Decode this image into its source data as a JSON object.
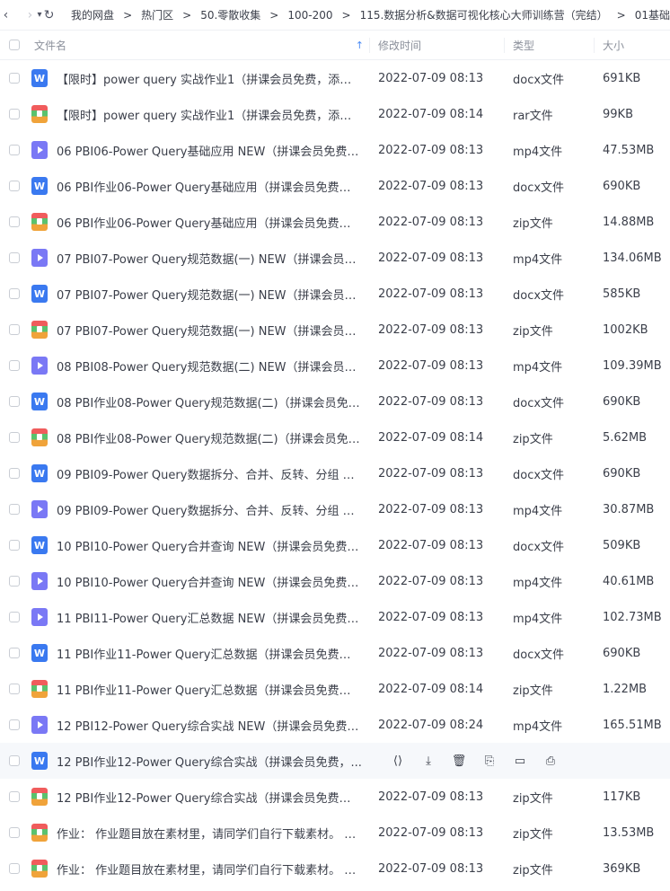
{
  "nav": {
    "back": "‹",
    "forward": "›",
    "dropdown": "▾",
    "refresh": "↻"
  },
  "breadcrumbs": [
    "我的网盘",
    "热门区",
    "50.零散收集",
    "100-200",
    "115.数据分析&数据可视化核心大师训练营（完结）",
    "01基础"
  ],
  "crumb_sep": ">",
  "columns": {
    "name": "文件名",
    "time": "修改时间",
    "type": "类型",
    "size": "大小"
  },
  "files": [
    {
      "icon": "docx",
      "name": "【限时】power query 实战作业1（拼课会员免费，添加微信...",
      "time": "2022-07-09 08:13",
      "type": "docx文件",
      "size": "691KB"
    },
    {
      "icon": "zip",
      "name": "【限时】power query 实战作业1（拼课会员免费，添加微信...",
      "time": "2022-07-09 08:14",
      "type": "rar文件",
      "size": "99KB"
    },
    {
      "icon": "mp4",
      "name": "06  PBI06-Power Query基础应用 NEW（拼课会员免费，添...",
      "time": "2022-07-09 08:13",
      "type": "mp4文件",
      "size": "47.53MB"
    },
    {
      "icon": "docx",
      "name": "06 PBI作业06-Power Query基础应用（拼课会员免费，添加...",
      "time": "2022-07-09 08:13",
      "type": "docx文件",
      "size": "690KB"
    },
    {
      "icon": "zip",
      "name": "06 PBI作业06-Power Query基础应用（拼课会员免费，添加...",
      "time": "2022-07-09 08:13",
      "type": "zip文件",
      "size": "14.88MB"
    },
    {
      "icon": "mp4",
      "name": "07 PBI07-Power Query规范数据(一) NEW（拼课会员免费，...",
      "time": "2022-07-09 08:13",
      "type": "mp4文件",
      "size": "134.06MB"
    },
    {
      "icon": "docx",
      "name": "07 PBI07-Power Query规范数据(一) NEW（拼课会员免费，...",
      "time": "2022-07-09 08:13",
      "type": "docx文件",
      "size": "585KB"
    },
    {
      "icon": "zip",
      "name": "07 PBI07-Power Query规范数据(一) NEW（拼课会员免费，...",
      "time": "2022-07-09 08:13",
      "type": "zip文件",
      "size": "1002KB"
    },
    {
      "icon": "mp4",
      "name": "08 PBI08-Power Query规范数据(二) NEW（拼课会员免费，...",
      "time": "2022-07-09 08:13",
      "type": "mp4文件",
      "size": "109.39MB"
    },
    {
      "icon": "docx",
      "name": "08 PBI作业08-Power Query规范数据(二)（拼课会员免费，...",
      "time": "2022-07-09 08:13",
      "type": "docx文件",
      "size": "690KB"
    },
    {
      "icon": "zip",
      "name": "08 PBI作业08-Power Query规范数据(二)（拼课会员免费，...",
      "time": "2022-07-09 08:14",
      "type": "zip文件",
      "size": "5.62MB"
    },
    {
      "icon": "docx",
      "name": "09 PBI09-Power Query数据拆分、合并、反转、分组 NEW...",
      "time": "2022-07-09 08:13",
      "type": "docx文件",
      "size": "690KB"
    },
    {
      "icon": "mp4",
      "name": "09 PBI09-Power Query数据拆分、合并、反转、分组 NEW...",
      "time": "2022-07-09 08:13",
      "type": "mp4文件",
      "size": "30.87MB"
    },
    {
      "icon": "docx",
      "name": "10 PBI10-Power Query合并查询 NEW（拼课会员免费，添...",
      "time": "2022-07-09 08:13",
      "type": "docx文件",
      "size": "509KB"
    },
    {
      "icon": "mp4",
      "name": "10 PBI10-Power Query合并查询 NEW（拼课会员免费，添...",
      "time": "2022-07-09 08:13",
      "type": "mp4文件",
      "size": "40.61MB"
    },
    {
      "icon": "mp4",
      "name": "11 PBI11-Power Query汇总数据 NEW（拼课会员免费，添...",
      "time": "2022-07-09 08:13",
      "type": "mp4文件",
      "size": "102.73MB"
    },
    {
      "icon": "docx",
      "name": "11 PBI作业11-Power Query汇总数据（拼课会员免费，添加...",
      "time": "2022-07-09 08:13",
      "type": "docx文件",
      "size": "690KB"
    },
    {
      "icon": "zip",
      "name": "11 PBI作业11-Power Query汇总数据（拼课会员免费，添加...",
      "time": "2022-07-09 08:14",
      "type": "zip文件",
      "size": "1.22MB"
    },
    {
      "icon": "mp4",
      "name": "12 PBI12-Power Query综合实战 NEW（拼课会员免费，添...",
      "time": "2022-07-09 08:24",
      "type": "mp4文件",
      "size": "165.51MB"
    },
    {
      "icon": "docx",
      "name": "12 PBI作业12-Power Query综合实战（拼课会员免费，...",
      "time": "",
      "type": "",
      "size": "",
      "hover": true
    },
    {
      "icon": "zip",
      "name": "12 PBI作业12-Power Query综合实战（拼课会员免费，添加...",
      "time": "2022-07-09 08:13",
      "type": "zip文件",
      "size": "117KB"
    },
    {
      "icon": "zip",
      "name": "作业： 作业题目放在素材里，请同学们自行下载素材。 做作...",
      "time": "2022-07-09 08:13",
      "type": "zip文件",
      "size": "13.53MB"
    },
    {
      "icon": "zip",
      "name": "作业： 作业题目放在素材里，请同学们自行下载素材。 做作...",
      "time": "2022-07-09 08:13",
      "type": "zip文件",
      "size": "369KB"
    }
  ],
  "hover_actions": [
    {
      "name": "share",
      "glyph": "⟨⟩"
    },
    {
      "name": "download",
      "glyph": "⤓"
    },
    {
      "name": "delete",
      "glyph": "🗑"
    },
    {
      "name": "rename",
      "glyph": "⎘"
    },
    {
      "name": "copy",
      "glyph": "▭"
    },
    {
      "name": "more",
      "glyph": "⎙"
    }
  ]
}
